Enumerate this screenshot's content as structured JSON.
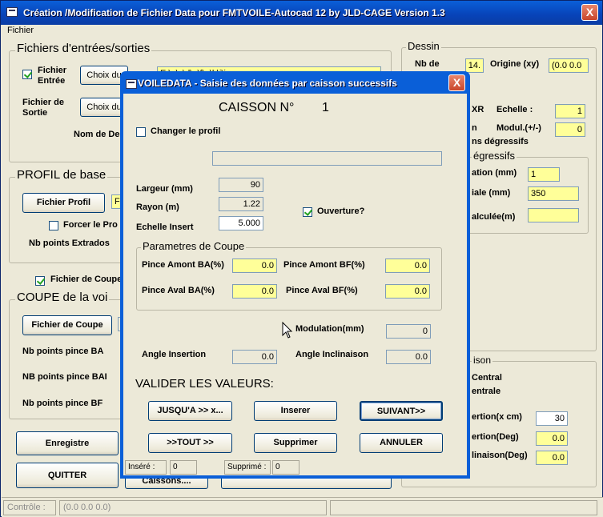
{
  "app": {
    "title": "Création /Modification de Fichier Data pour FMTVOILE-Autocad 12 by JLD-CAGE    Version 1.3",
    "close": "X",
    "menu": "Fichier"
  },
  "left": {
    "fichiers": {
      "title": "Fichiers d'entrées/sorties",
      "fichier_entree": "Fichier Entrée",
      "choix1": "Choix du",
      "entree_path": "E:\\a\\c\\d\\e\\f\\g\\h\\i\\j",
      "fichier_sortie": "Fichier de Sortie",
      "choix2": "Choix du",
      "nom_de": "Nom de De"
    },
    "profil": {
      "title": "PROFIL de base",
      "btn": "Fichier Profil",
      "field": "F",
      "forcer": "Forcer le Pro",
      "nb_extrados": "Nb points Extrados"
    },
    "coupe": {
      "checkbox": "Fichier de Coupe",
      "title": "COUPE de la voi",
      "btn": "Fichier de Coupe",
      "nb_ba": "Nb points pince BA",
      "nb_bai": "NB points pince BAI",
      "nb_bf": "Nb points pince BF"
    },
    "enregistre": "Enregistre",
    "quitter": "QUITTER",
    "caissons": "Caissons...."
  },
  "right": {
    "dessin": "Dessin",
    "nb_de": "Nb de",
    "nb_val": "14.",
    "origine": "Origine (xy)",
    "origine_val": "(0.0 0.0",
    "xr": "XR",
    "echelle": "Echelle :",
    "echelle_val": "1",
    "modul_short": "n",
    "modul": "Modul.(+/-)",
    "modul_val": "0",
    "degressifs1": "ns dégressifs",
    "degressifs2": "égressifs",
    "ation": "ation (mm)",
    "ation_val": "1",
    "iale": "iale (mm)",
    "iale_val": "350",
    "calculee": "alculée(m)",
    "calculee_val": "",
    "ison": "ison",
    "central": "Central",
    "entrale": "entrale",
    "ertion_cm": "ertion(x cm)",
    "ertion_cm_val": "30",
    "ertion_deg": "ertion(Deg)",
    "ertion_deg_val": "0.0",
    "inaison": "linaison(Deg)",
    "inaison_val": "0.0"
  },
  "dialog": {
    "title": "VOILEDATA - Saisie des données par caisson successifs",
    "close": "X",
    "caisson_label": "CAISSON N°",
    "caisson_num": "1",
    "changer": "Changer le profil",
    "profil_field": "",
    "largeur": "Largeur (mm)",
    "largeur_val": "90",
    "rayon": "Rayon (m)",
    "rayon_val": "1.22",
    "echelle": "Echelle Insert",
    "echelle_val": "5.000",
    "ouverture": "Ouverture?",
    "params": "Parametres de Coupe",
    "pince_amont_ba": "Pince Amont BA(%)",
    "pince_amont_ba_val": "0.0",
    "pince_amont_bf": "Pince Amont BF(%)",
    "pince_amont_bf_val": "0.0",
    "pince_aval_ba": "Pince Aval  BA(%)",
    "pince_aval_ba_val": "0.0",
    "pince_aval_bf": "Pince Aval   BF(%)",
    "pince_aval_bf_val": "0.0",
    "modulation": "Modulation(mm)",
    "modulation_val": "0",
    "angle_ins": "Angle Insertion",
    "angle_ins_val": "0.0",
    "angle_incl": "Angle Inclinaison",
    "angle_incl_val": "0.0",
    "valider": "VALIDER LES VALEURS:",
    "jusqua": "JUSQU'A >>   x...",
    "inserer": "Inserer",
    "suivant": "SUIVANT>>",
    "tout": ">>TOUT >>",
    "supprimer": "Supprimer",
    "annuler": "ANNULER",
    "insere_lbl": "Inséré :",
    "insere_val": "0",
    "supprime_lbl": "Supprimé :",
    "supprime_val": "0"
  },
  "status": {
    "controle": "Contrôle :",
    "coords": "(0.0 0.0 0.0)"
  }
}
